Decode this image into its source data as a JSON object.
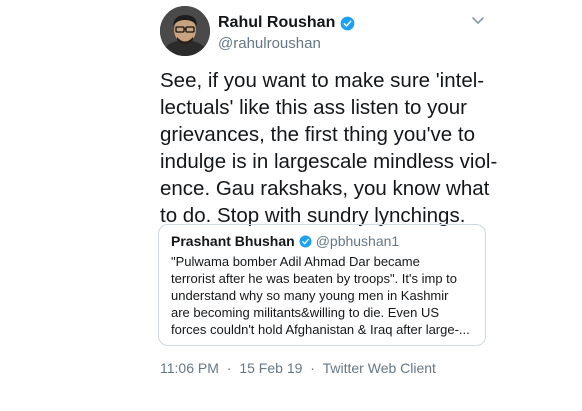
{
  "tweet": {
    "author": {
      "display_name": "Rahul Roushan",
      "handle": "@rahulroushan",
      "verified": true,
      "avatar_icon": "profile-photo-avatar"
    },
    "text_lines": [
      "See, if you want to make sure 'intel-",
      "lectuals' like this ass listen to your",
      "grievances, the first thing you've to",
      "indulge is in largescale mindless viol-",
      "ence. Gau rakshaks, you know what",
      "to do. Stop with sundry lynchings."
    ],
    "time": "11:06 PM",
    "separator": "·",
    "date": "15 Feb 19",
    "client": "Twitter Web Client"
  },
  "quoted_tweet": {
    "display_name": "Prashant Bhushan",
    "handle": "@pbhushan1",
    "verified": true,
    "text_lines": [
      "\"Pulwama bomber Adil Ahmad Dar became",
      "terrorist after he was beaten by troops\". It's imp to",
      "understand why so many young men in Kashmir",
      "are becoming militants&willing to die. Even US",
      "forces couldn't hold Afghanistan & Iraq after large-..."
    ]
  },
  "icons": {
    "verified": "verified-badge-icon",
    "caret": "chevron-down-icon"
  },
  "colors": {
    "verified_blue": "#1da1f2",
    "secondary_text": "#657786",
    "border": "#cfd9de"
  }
}
